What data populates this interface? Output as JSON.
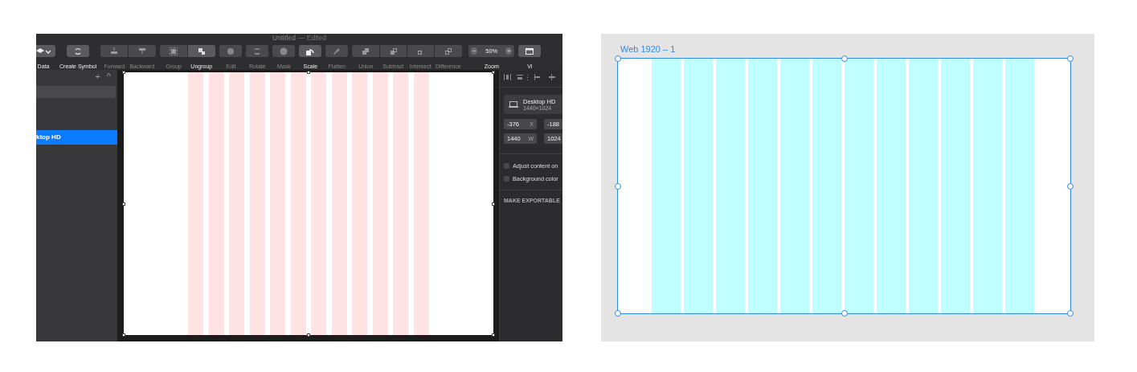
{
  "editor": {
    "window": {
      "title": "Untitled",
      "status": "— Edited"
    },
    "toolbar": [
      {
        "buttons": [
          {
            "label": "Data",
            "disabled": false
          }
        ]
      },
      {
        "buttons": [
          {
            "label": "Create Symbol",
            "disabled": false
          }
        ]
      },
      {
        "buttons": [
          {
            "label": "Forward",
            "disabled": true
          },
          {
            "label": "Backward",
            "disabled": true
          }
        ]
      },
      {
        "buttons": [
          {
            "label": "Group",
            "disabled": true
          },
          {
            "label": "Ungroup",
            "disabled": false
          }
        ]
      },
      {
        "buttons": [
          {
            "label": "Edit",
            "disabled": true
          }
        ]
      },
      {
        "buttons": [
          {
            "label": "Rotate",
            "disabled": true
          }
        ]
      },
      {
        "buttons": [
          {
            "label": "Mask",
            "disabled": true
          }
        ]
      },
      {
        "buttons": [
          {
            "label": "Scale",
            "disabled": false
          }
        ]
      },
      {
        "buttons": [
          {
            "label": "Flatten",
            "disabled": true
          }
        ]
      },
      {
        "buttons": [
          {
            "label": "Union",
            "disabled": true
          },
          {
            "label": "Subtract",
            "disabled": true
          },
          {
            "label": "Intersect",
            "disabled": true
          },
          {
            "label": "Difference",
            "disabled": true
          }
        ]
      }
    ],
    "zoom": {
      "label": "Zoom",
      "value": "50%",
      "minus": "−",
      "plus": "+"
    },
    "view": {
      "label": "Vi"
    },
    "sidebar": {
      "add": "+",
      "collapse": "^",
      "layers": [
        {
          "label": "ktop HD",
          "selected": true
        }
      ]
    },
    "inspector": {
      "artboard": {
        "name": "Desktop HD",
        "size": "1440×1024"
      },
      "fields": [
        {
          "value": "-376",
          "suffix": "X"
        },
        {
          "value": "-188"
        },
        {
          "value": "1440",
          "suffix": "W"
        },
        {
          "value": "1024"
        }
      ],
      "options": [
        {
          "label": "Adjust content on",
          "checked": false
        },
        {
          "label": "Background color",
          "checked": false
        }
      ],
      "section": "MAKE EXPORTABLE"
    }
  },
  "design": {
    "artboard": {
      "title": "Web 1920 – 1",
      "selected": true
    }
  }
}
